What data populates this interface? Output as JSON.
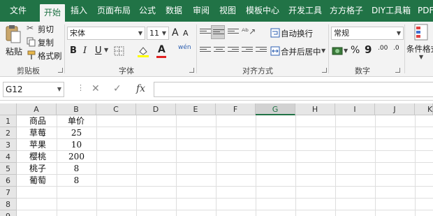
{
  "menu": {
    "tabs": [
      "文件",
      "开始",
      "插入",
      "页面布局",
      "公式",
      "数据",
      "审阅",
      "视图",
      "模板中心",
      "开发工具",
      "方方格子",
      "DIY工具箱",
      "PDF"
    ],
    "active": "开始"
  },
  "ribbon": {
    "clipboard": {
      "paste": "粘贴",
      "cut": "剪切",
      "copy": "复制",
      "format_painter": "格式刷",
      "label": "剪贴板"
    },
    "font": {
      "name": "宋体",
      "size": "11",
      "label": "字体",
      "bold": "B",
      "italic": "I",
      "underline": "U",
      "grow": "A",
      "shrink": "A",
      "font_color_glyph": "A",
      "phonetic": "wén"
    },
    "alignment": {
      "wrap": "自动换行",
      "merge": "合并后居中",
      "label": "对齐方式"
    },
    "number": {
      "format": "常规",
      "percent": "%",
      "comma": "9",
      "inc_decimal": ".00",
      "dec_decimal": ".0",
      "label": "数字"
    },
    "styles": {
      "conditional": "条件格式"
    }
  },
  "formula_bar": {
    "name_box": "G12",
    "fx": "fx",
    "value": ""
  },
  "grid": {
    "columns": [
      "A",
      "B",
      "C",
      "D",
      "E",
      "F",
      "G",
      "H",
      "I",
      "J",
      "K"
    ],
    "selected_column": "G",
    "rows": [
      "1",
      "2",
      "3",
      "4",
      "5",
      "6",
      "7",
      "8",
      "9"
    ],
    "cells": [
      [
        "商品",
        "单价"
      ],
      [
        "草莓",
        "25"
      ],
      [
        "苹果",
        "10"
      ],
      [
        "樱桃",
        "200"
      ],
      [
        "桃子",
        "8"
      ],
      [
        "葡萄",
        "8"
      ]
    ]
  }
}
